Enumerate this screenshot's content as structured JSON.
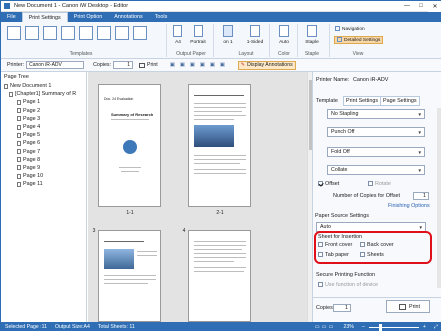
{
  "window": {
    "title": "New Document 1 - Canon iW Desktop - Editor",
    "controls": [
      "—",
      "□",
      "✕"
    ]
  },
  "tabs": [
    "File",
    "Print Settings",
    "Print Option",
    "Annotations",
    "Tools"
  ],
  "ribbon": {
    "groups": [
      "Templates",
      "Output Paper",
      "Layout",
      "Color",
      "Staple",
      "View"
    ],
    "output_paper": {
      "size": "A4",
      "orientation": "Portrait"
    },
    "layout": {
      "pages_per_sheet": "1",
      "pages_label": "on 1",
      "sided": "1-Sided"
    },
    "color": {
      "mode": "Auto"
    },
    "staple": {
      "label": "Staple"
    },
    "view": {
      "navigation": "Navigation",
      "detailed": "Detailed Settings"
    }
  },
  "toolbar": {
    "printer_label": "Printer:",
    "printer_value": "Canon iR-ADV",
    "copies_label": "Copies:",
    "copies_value": "1",
    "print_label": "Print",
    "display_annotations": "Display Annotations"
  },
  "tree": {
    "title": "Page Tree",
    "document": "New Document 1",
    "chapter": "[Chapter1] Summary of R",
    "pages": [
      "Page 1",
      "Page 2",
      "Page 3",
      "Page 4",
      "Page 5",
      "Page 6",
      "Page 7",
      "Page 8",
      "Page 9",
      "Page 10",
      "Page 11"
    ]
  },
  "thumbs": {
    "labels": [
      "1-1",
      "2-1",
      "3",
      "4"
    ],
    "doc1_title": "Summary of Research",
    "doc1_heading": "Doc. 24 Evaluation"
  },
  "panel": {
    "printer_name_label": "Printer Name:",
    "printer_name_value": "Canon iR-ADV",
    "tabs": [
      "Template",
      "Print Settings",
      "Page Settings"
    ],
    "finishing": {
      "staple": "No Stapling",
      "punch": "Punch Off",
      "fold": "Fold Off",
      "collate": "Collate"
    },
    "offset_label": "Offset",
    "rotate_label": "Rotate",
    "num_copies_offset_label": "Number of Copies for Offset",
    "num_copies_offset_value": "1",
    "finishing_options": "Finishing Options",
    "paper_source_label": "Paper Source Settings",
    "paper_source_value": "Auto",
    "sheet_for_insertion": "Sheet for Insertion",
    "front_cover": "Front cover",
    "back_cover": "Back cover",
    "tab_paper": "Tab paper",
    "sheets": "Sheets",
    "secure_printing": "Secure Printing Function",
    "use_function": "Use function of device",
    "copies_label": "Copies:",
    "copies_value": "1",
    "print_button": "Print"
  },
  "status": {
    "selected_page": "Selected Page :11",
    "output_size": "Output Size:A4",
    "total_sheets": "Total Sheets: 11",
    "zoom": "23%"
  },
  "colors": {
    "accent": "#2f6eb5",
    "highlight": "#e0101a"
  }
}
